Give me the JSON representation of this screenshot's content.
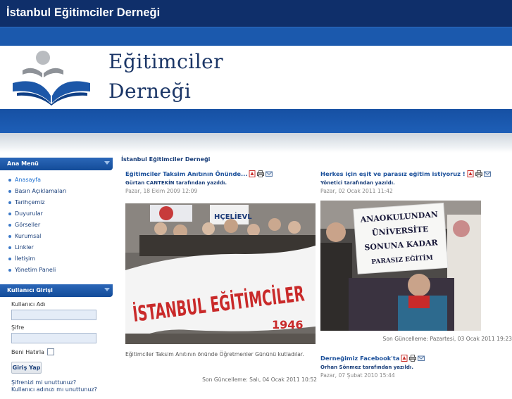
{
  "site": {
    "title": "İstanbul Eğitimciler Derneği",
    "banner_line1": "Eğitimciler",
    "banner_line2": "Derneği"
  },
  "sidebar": {
    "main_menu_title": "Ana Menü",
    "items": [
      {
        "label": "Anasayfa"
      },
      {
        "label": "Basın Açıklamaları"
      },
      {
        "label": "Tarihçemiz"
      },
      {
        "label": "Duyurular"
      },
      {
        "label": "Görseller"
      },
      {
        "label": "Kurumsal"
      },
      {
        "label": "Linkler"
      },
      {
        "label": "İletişim"
      },
      {
        "label": "Yönetim Paneli"
      }
    ],
    "login": {
      "title": "Kullanıcı Girişi",
      "username_label": "Kullanıcı Adı",
      "password_label": "Şifre",
      "remember_label": "Beni Hatırla",
      "button_label": "Giriş Yap",
      "forgot_password": "Şifrenizi mi unuttunuz?",
      "forgot_username": "Kullanıcı adınızı mı unuttunuz?"
    }
  },
  "main": {
    "breadcrumb": "İstanbul Eğitimciler Derneği",
    "articles": [
      {
        "title": "Eğitimciler Taksim Anıtının Önünde...",
        "author": "Gürtan CANTEKİN tarafından yazıldı.",
        "date": "Pazar, 18 Ekim 2009 12:09",
        "photo_banner_text": "İSTANBUL EĞİTİMCİLER",
        "photo_banner_year": "1946",
        "photo_sign_text": "HÇELİEVL",
        "caption": "Eğitimciler Taksim Anıtının önünde Öğretmenler Gününü kutladılar.",
        "updated": "Son Güncelleme: Salı, 04 Ocak 2011 10:52"
      },
      {
        "title": "Herkes için eşit ve parasız eğitim istiyoruz !",
        "author": "Yönetici tarafından yazıldı.",
        "date": "Pazar, 02 Ocak 2011 11:42",
        "photo_sign_lines": [
          "ANAOKULUNDAN",
          "ÜNİVERSİTE",
          "SONUNA KADAR",
          "PARASIZ EĞİTİM"
        ],
        "updated": "Son Güncelleme: Pazartesi, 03 Ocak 2011 19:23"
      },
      {
        "title": "Derneğimiz Facebook'ta",
        "author": "Orhan Sönmez tarafından yazıldı.",
        "date": "Pazar, 07 Şubat 2010 15:44"
      }
    ]
  },
  "colors": {
    "topbar": "#0f2f6a",
    "accent_blue": "#1b59ad",
    "link": "#1a4f9a"
  }
}
